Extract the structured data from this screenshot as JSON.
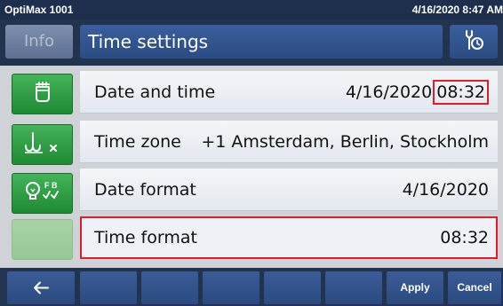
{
  "status_bar": {
    "device_name": "OptiMax 1001",
    "datetime": "4/16/2020 8:47 AM"
  },
  "header": {
    "info_label": "Info",
    "title": "Time settings",
    "tools_icon": "wrench-clock-icon"
  },
  "side_buttons": [
    {
      "icon": "reactor-vessel-icon",
      "enabled": true
    },
    {
      "icon": "stirrer-off-icon",
      "enabled": true
    },
    {
      "icon": "lamp-fb-icon",
      "enabled": true
    },
    {
      "icon": "",
      "enabled": false
    }
  ],
  "settings": [
    {
      "label": "Date and time",
      "value_date": "4/16/2020",
      "value_time": "08:32"
    },
    {
      "label": "Time zone",
      "value": "+1 Amsterdam, Berlin, Stockholm"
    },
    {
      "label": "Date format",
      "value": "4/16/2020"
    },
    {
      "label": "Time format",
      "value": "08:32",
      "selected": true
    }
  ],
  "bottom_bar": {
    "back_icon": "back-arrow-icon",
    "apply_label": "Apply",
    "cancel_label": "Cancel"
  },
  "colors": {
    "dark_navy": "#22334f",
    "button_blue": "#2b4b82",
    "green": "#1f8a34",
    "highlight_red": "#e01c2c"
  }
}
